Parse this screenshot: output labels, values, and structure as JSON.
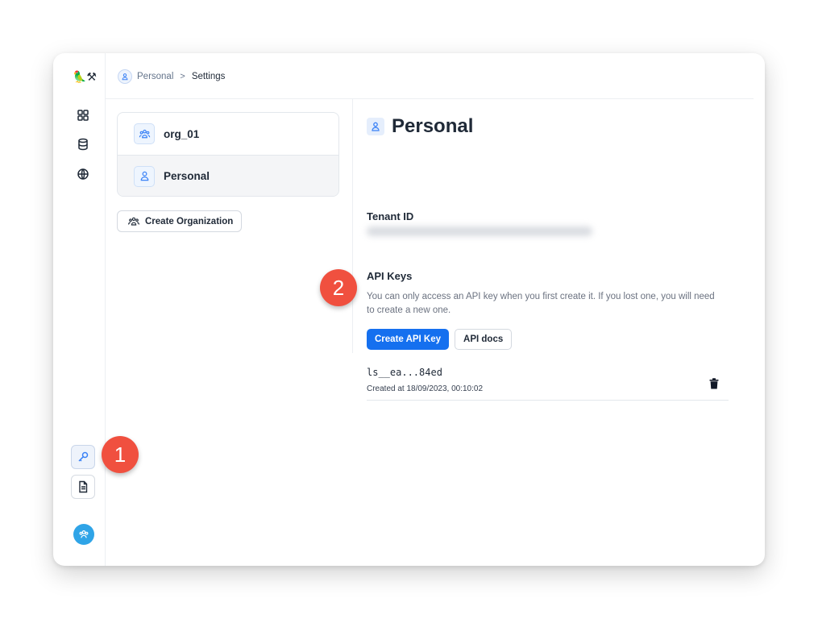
{
  "app": {
    "logo_emoji": "🦜⚒"
  },
  "breadcrumb": {
    "parent": "Personal",
    "separator": ">",
    "current": "Settings"
  },
  "rail": {
    "icons": [
      "projects-grid-icon",
      "datasets-icon",
      "hub-globe-icon",
      "api-key-icon",
      "docs-icon",
      "avatar-icon"
    ]
  },
  "organizations": [
    {
      "name": "org_01",
      "icon": "group-icon",
      "selected": false
    },
    {
      "name": "Personal",
      "icon": "person-icon",
      "selected": true
    }
  ],
  "create_org_label": "Create Organization",
  "panel": {
    "title": "Personal",
    "tenant_label": "Tenant ID",
    "api_keys_label": "API Keys",
    "description": "You can only access an API key when you first create it. If you lost one, you will need to create a new one.",
    "create_key_label": "Create API Key",
    "api_docs_label": "API docs",
    "keys": [
      {
        "masked": "ls__ea...84ed",
        "created": "Created at 18/09/2023, 00:10:02"
      }
    ]
  },
  "callouts": {
    "one": "1",
    "two": "2"
  },
  "colors": {
    "primary": "#1570ef",
    "callout": "#f0503f",
    "avatar": "#2fa4e7"
  }
}
